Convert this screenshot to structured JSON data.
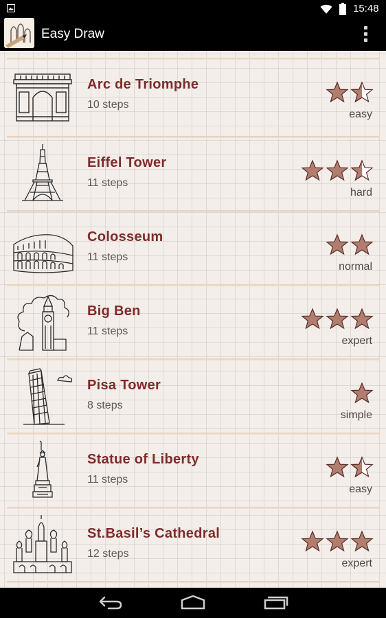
{
  "status_bar": {
    "time": "15:48"
  },
  "action_bar": {
    "title": "Easy Draw",
    "overflow_icon": "more-vert-icon"
  },
  "items": [
    {
      "title": "Arc de Triomphe",
      "steps": "10 steps",
      "rating": 1.5,
      "difficulty": "easy",
      "thumbnail": "arc-de-triomphe"
    },
    {
      "title": "Eiffel Tower",
      "steps": "11 steps",
      "rating": 2.5,
      "difficulty": "hard",
      "thumbnail": "eiffel-tower"
    },
    {
      "title": "Colosseum",
      "steps": "11 steps",
      "rating": 2,
      "difficulty": "normal",
      "thumbnail": "colosseum"
    },
    {
      "title": "Big Ben",
      "steps": "11 steps",
      "rating": 3,
      "difficulty": "expert",
      "thumbnail": "big-ben"
    },
    {
      "title": "Pisa Tower",
      "steps": "8 steps",
      "rating": 1,
      "difficulty": "simple",
      "thumbnail": "pisa-tower"
    },
    {
      "title": "Statue of Liberty",
      "steps": "11 steps",
      "rating": 1.5,
      "difficulty": "easy",
      "thumbnail": "statue-of-liberty"
    },
    {
      "title": "St.Basil’s Cathedral",
      "steps": "12 steps",
      "rating": 3,
      "difficulty": "expert",
      "thumbnail": "st-basils-cathedral"
    }
  ],
  "nav_bar": {
    "back_icon": "back-icon",
    "home_icon": "home-icon",
    "recents_icon": "recents-icon"
  },
  "colors": {
    "title_text": "#7e2b2b",
    "star_fill": "#b07d6f",
    "star_outline": "#5a2f2a"
  }
}
